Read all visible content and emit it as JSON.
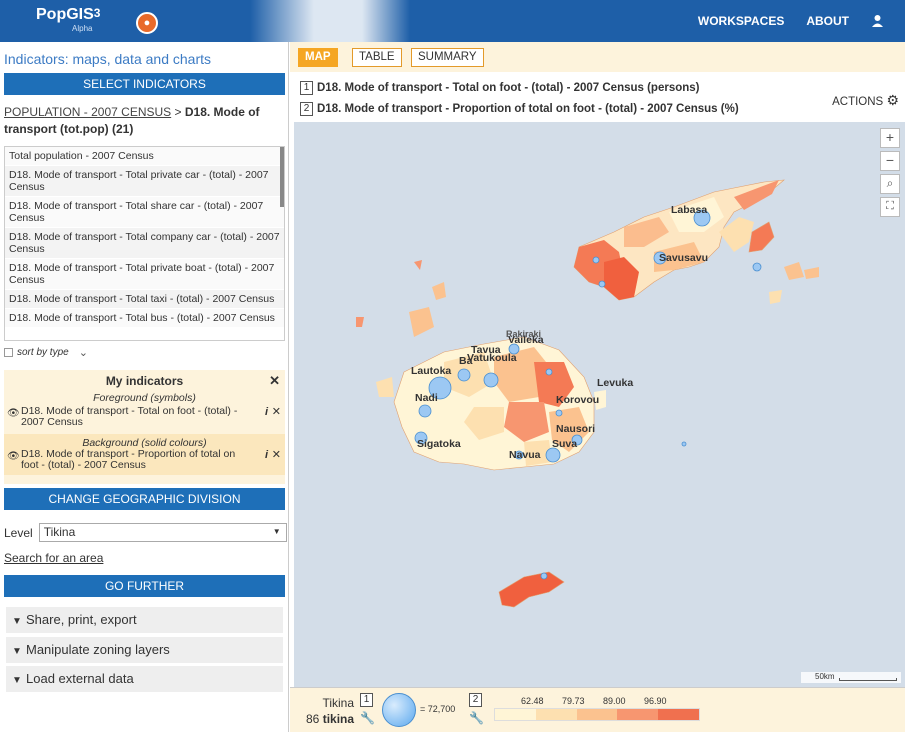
{
  "header": {
    "app_name": "PopGIS",
    "app_version": "3",
    "app_sub": "Alpha",
    "nav": [
      "WORKSPACES",
      "ABOUT"
    ]
  },
  "sidebar": {
    "title": "Indicators: maps, data and charts",
    "select_indicators": "SELECT INDICATORS",
    "breadcrumb_link": "POPULATION - 2007 CENSUS",
    "breadcrumb_sep": ">",
    "breadcrumb_current": "D18. Mode of transport (tot.pop) (21)",
    "indicator_list": [
      "Total population - 2007 Census",
      "D18. Mode of transport - Total private car - (total) - 2007 Census",
      "D18. Mode of transport - Total share car - (total) - 2007 Census",
      "D18. Mode of transport - Total company car - (total) - 2007 Census",
      "D18. Mode of transport - Total private boat - (total) - 2007 Census",
      "D18. Mode of transport - Total taxi - (total) - 2007 Census",
      "D18. Mode of transport - Total bus - (total) - 2007 Census"
    ],
    "sort_label": "sort by type",
    "my_indicators": {
      "title": "My indicators",
      "foreground_label": "Foreground (symbols)",
      "foreground_item": "D18. Mode of transport - Total on foot - (total) - 2007 Census",
      "background_label": "Background (solid colours)",
      "background_item": "D18. Mode of transport - Proportion of total on foot - (total) - 2007 Census"
    },
    "change_geo": "CHANGE GEOGRAPHIC DIVISION",
    "level_label": "Level",
    "level_value": "Tikina",
    "search_area": "Search for an area",
    "go_further": "GO FURTHER",
    "accordion": [
      "Share, print, export",
      "Manipulate zoning layers",
      "Load external data"
    ]
  },
  "main": {
    "tabs": [
      "MAP",
      "TABLE",
      "SUMMARY"
    ],
    "title1_num": "1",
    "title1": "D18. Mode of transport - Total on foot - (total) - 2007 Census (persons)",
    "title2_num": "2",
    "title2": "D18. Mode of transport - Proportion of total on foot - (total) - 2007 Census (%)",
    "actions": "ACTIONS",
    "map_labels": [
      {
        "name": "Labasa"
      },
      {
        "name": "Savusavu"
      },
      {
        "name": "Vaileka"
      },
      {
        "name": "Rakiraki"
      },
      {
        "name": "Tavua"
      },
      {
        "name": "Ba"
      },
      {
        "name": "Vatukoula"
      },
      {
        "name": "Lautoka"
      },
      {
        "name": "Nadi"
      },
      {
        "name": "Levuka"
      },
      {
        "name": "Korovou"
      },
      {
        "name": "Nausori"
      },
      {
        "name": "Sigatoka"
      },
      {
        "name": "Suva"
      },
      {
        "name": "Navua"
      }
    ],
    "scale_label": "50km"
  },
  "legend": {
    "unit_label": "Tikina",
    "count": "86",
    "count_unit": "tikina",
    "box1": "1",
    "box2": "2",
    "circle_value": "= 72,700",
    "breaks": [
      "62.48",
      "79.73",
      "89.00",
      "96.90"
    ],
    "colors": [
      "#fff5d6",
      "#fde0b0",
      "#fbc28f",
      "#f79670",
      "#f0704f"
    ]
  }
}
